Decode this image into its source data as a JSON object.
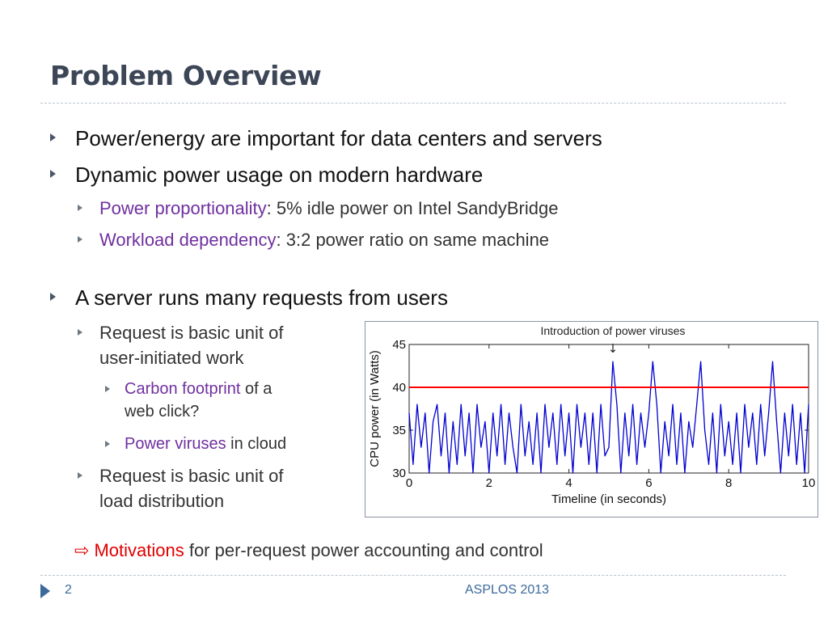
{
  "slide": {
    "title": "Problem Overview",
    "bullets": {
      "b1": "Power/energy are important for data centers and servers",
      "b2": "Dynamic power usage on modern hardware",
      "b2_sub1_hl": "Power proportionality",
      "b2_sub1_rest": ": 5% idle power on Intel SandyBridge",
      "b2_sub2_hl": "Workload dependency",
      "b2_sub2_rest": ": 3:2 power ratio on same machine",
      "b3": "A server runs many requests from users",
      "b3_sub1_line1": "Request is basic unit of",
      "b3_sub1_line2": "user-initiated work",
      "b3_sub1_sub1_hl": "Carbon footprint",
      "b3_sub1_sub1_rest": " of a",
      "b3_sub1_sub1_line2": "web click?",
      "b3_sub1_sub2_hl": "Power viruses",
      "b3_sub1_sub2_rest": " in cloud",
      "b3_sub2_line1": "Request is basic unit of",
      "b3_sub2_line2": "load distribution"
    },
    "conclusion": {
      "arrow": "⇨",
      "hl": "Motivations",
      "rest": " for per-request power accounting and control"
    },
    "footer": {
      "page_number": "2",
      "text": "ASPLOS 2013"
    }
  },
  "colors": {
    "title": "#3c4656",
    "highlight": "#7030a0",
    "accent_red": "#e00000",
    "series_blue": "#0000d0",
    "threshold_red": "#ff0000",
    "footer": "#3c6a9c"
  },
  "chart_data": {
    "type": "line",
    "annotation": "Introduction of power viruses",
    "annotation_arrow": "↓",
    "annotation_x": 5.1,
    "xlabel": "Timeline (in seconds)",
    "ylabel": "CPU power (in Watts)",
    "xlim": [
      0,
      10
    ],
    "ylim": [
      30,
      45
    ],
    "x_ticks": [
      0,
      2,
      4,
      6,
      8,
      10
    ],
    "y_ticks": [
      30,
      35,
      40,
      45
    ],
    "threshold": {
      "y": 40
    },
    "series": [
      {
        "x": [
          0,
          0.1,
          0.2,
          0.3,
          0.4,
          0.5,
          0.6,
          0.7,
          0.8,
          0.9,
          1.0,
          1.1,
          1.2,
          1.3,
          1.4,
          1.5,
          1.6,
          1.7,
          1.8,
          1.9,
          2.0,
          2.1,
          2.2,
          2.3,
          2.4,
          2.5,
          2.6,
          2.7,
          2.8,
          2.9,
          3.0,
          3.1,
          3.2,
          3.3,
          3.4,
          3.5,
          3.6,
          3.7,
          3.8,
          3.9,
          4.0,
          4.1,
          4.2,
          4.3,
          4.4,
          4.5,
          4.6,
          4.7,
          4.8,
          4.9,
          5.0,
          5.1,
          5.2,
          5.3,
          5.4,
          5.5,
          5.6,
          5.7,
          5.8,
          5.9,
          6.0,
          6.1,
          6.2,
          6.3,
          6.4,
          6.5,
          6.6,
          6.7,
          6.8,
          6.9,
          7.0,
          7.1,
          7.2,
          7.3,
          7.4,
          7.5,
          7.6,
          7.7,
          7.8,
          7.9,
          8.0,
          8.1,
          8.2,
          8.3,
          8.4,
          8.5,
          8.6,
          8.7,
          8.8,
          8.9,
          9.0,
          9.1,
          9.2,
          9.3,
          9.4,
          9.5,
          9.6,
          9.7,
          9.8,
          9.9,
          10.0
        ],
        "values": [
          37,
          31,
          38,
          33,
          37,
          30,
          36,
          38,
          32,
          37,
          30,
          36,
          31,
          38,
          32,
          37,
          30,
          38,
          33,
          36,
          30,
          37,
          32,
          38,
          31,
          37,
          33,
          30,
          38,
          32,
          36,
          31,
          37,
          30,
          38,
          33,
          37,
          31,
          38,
          32,
          37,
          30,
          38,
          33,
          37,
          31,
          37,
          30,
          38,
          32,
          33,
          43,
          38,
          30,
          37,
          32,
          38,
          31,
          37,
          33,
          37,
          43,
          38,
          30,
          36,
          32,
          38,
          31,
          37,
          30,
          36,
          33,
          38,
          43,
          35,
          31,
          37,
          30,
          38,
          32,
          36,
          31,
          37,
          30,
          38,
          33,
          37,
          31,
          38,
          32,
          37,
          43,
          36,
          30,
          37,
          32,
          38,
          31,
          37,
          30,
          38
        ]
      }
    ]
  }
}
